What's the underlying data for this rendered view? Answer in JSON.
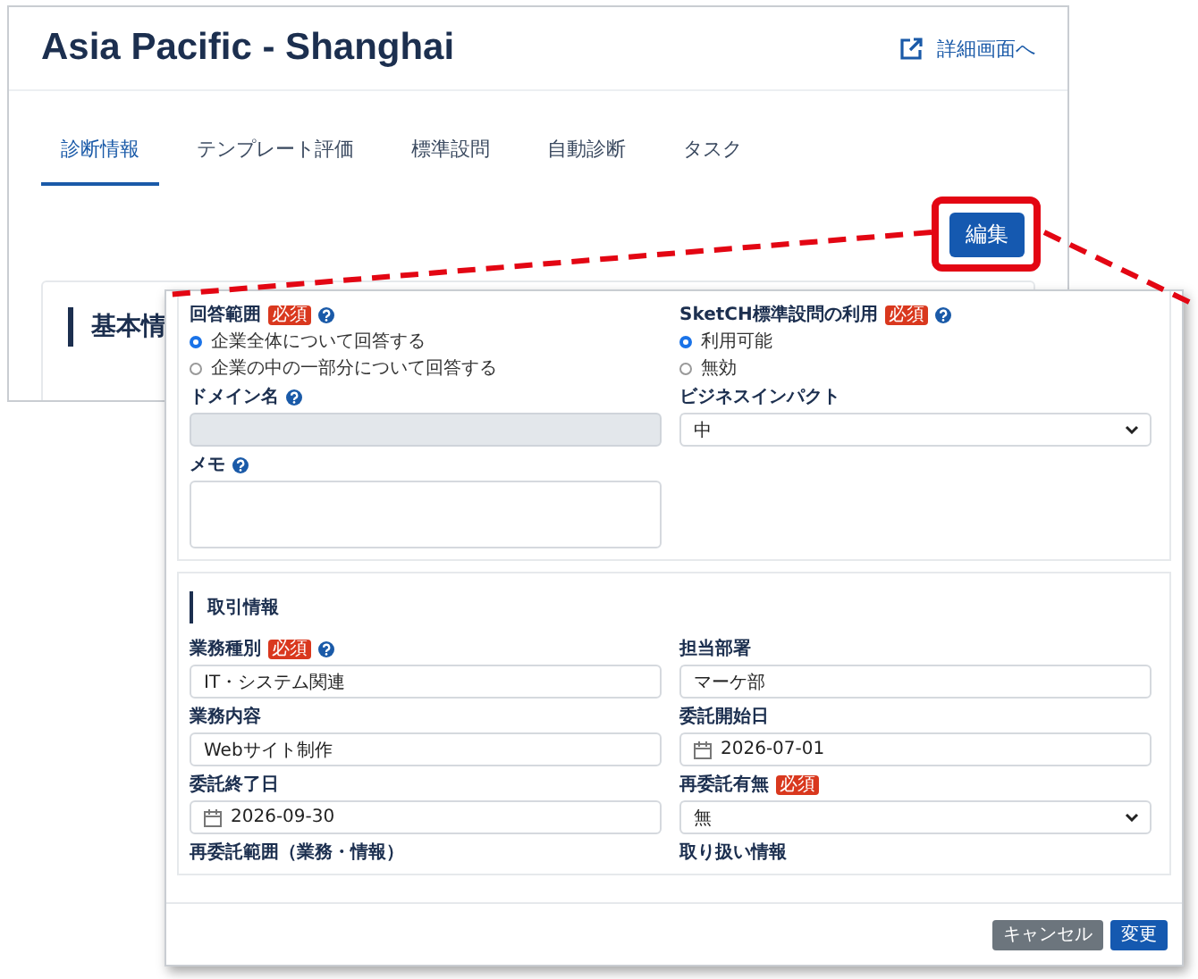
{
  "page": {
    "title": "Asia Pacific - Shanghai",
    "detail_link": "詳細画面へ"
  },
  "tabs": [
    {
      "label": "診断情報",
      "selected": true
    },
    {
      "label": "テンプレート評価",
      "selected": false
    },
    {
      "label": "標準設問",
      "selected": false
    },
    {
      "label": "自動診断",
      "selected": false
    },
    {
      "label": "タスク",
      "selected": false
    }
  ],
  "edit_button": {
    "label": "編集"
  },
  "card": {
    "title": "基本情"
  },
  "modal": {
    "sections": [
      {
        "fields": [
          {
            "label": "回答範囲",
            "badge": "必須",
            "help": true,
            "kind": "radio",
            "options": [
              {
                "label": "企業全体について回答する",
                "selected": true
              },
              {
                "label": "企業の中の一部分について回答する",
                "selected": false
              }
            ]
          },
          {
            "label": "SketCH標準設問の利用",
            "badge": "必須",
            "help": true,
            "kind": "radio",
            "options": [
              {
                "label": "利用可能",
                "selected": true
              },
              {
                "label": "無効",
                "selected": false
              }
            ]
          },
          {
            "label": "ドメイン名",
            "help": true,
            "kind": "text",
            "disabled": true
          },
          {
            "label": "ビジネスインパクト",
            "help": false,
            "kind": "select",
            "value": "中",
            "disabled": false
          },
          {
            "label": "メモ",
            "help": true,
            "kind": "textarea",
            "disabled": false
          }
        ]
      },
      {
        "title": "取引情報",
        "fields": [
          {
            "label": "業務種別",
            "badge": "必須",
            "help": true,
            "kind": "text",
            "value": "IT・システム関連",
            "disabled": false
          },
          {
            "label": "担当部署",
            "help": false,
            "kind": "text",
            "value": "マーケ部",
            "disabled": false
          },
          {
            "label": "業務内容",
            "help": false,
            "kind": "text",
            "value": "Webサイト制作",
            "disabled": false
          },
          {
            "label": "委託開始日",
            "help": false,
            "kind": "date",
            "value": "2026-07-01",
            "disabled": false
          },
          {
            "label": "委託終了日",
            "help": false,
            "kind": "date",
            "value": "2026-09-30",
            "disabled": false
          },
          {
            "label": "再委託有無",
            "badge": "必須",
            "help": false,
            "kind": "select",
            "value": "無",
            "disabled": false
          },
          {
            "label": "再委託範囲（業務・情報）",
            "help": false,
            "kind": "clipped"
          },
          {
            "label": "取り扱い情報",
            "help": false,
            "kind": "clipped"
          }
        ]
      }
    ],
    "buttons": [
      {
        "label": "キャンセル",
        "kind": "secondary"
      },
      {
        "label": "変更",
        "kind": "primary"
      }
    ]
  }
}
